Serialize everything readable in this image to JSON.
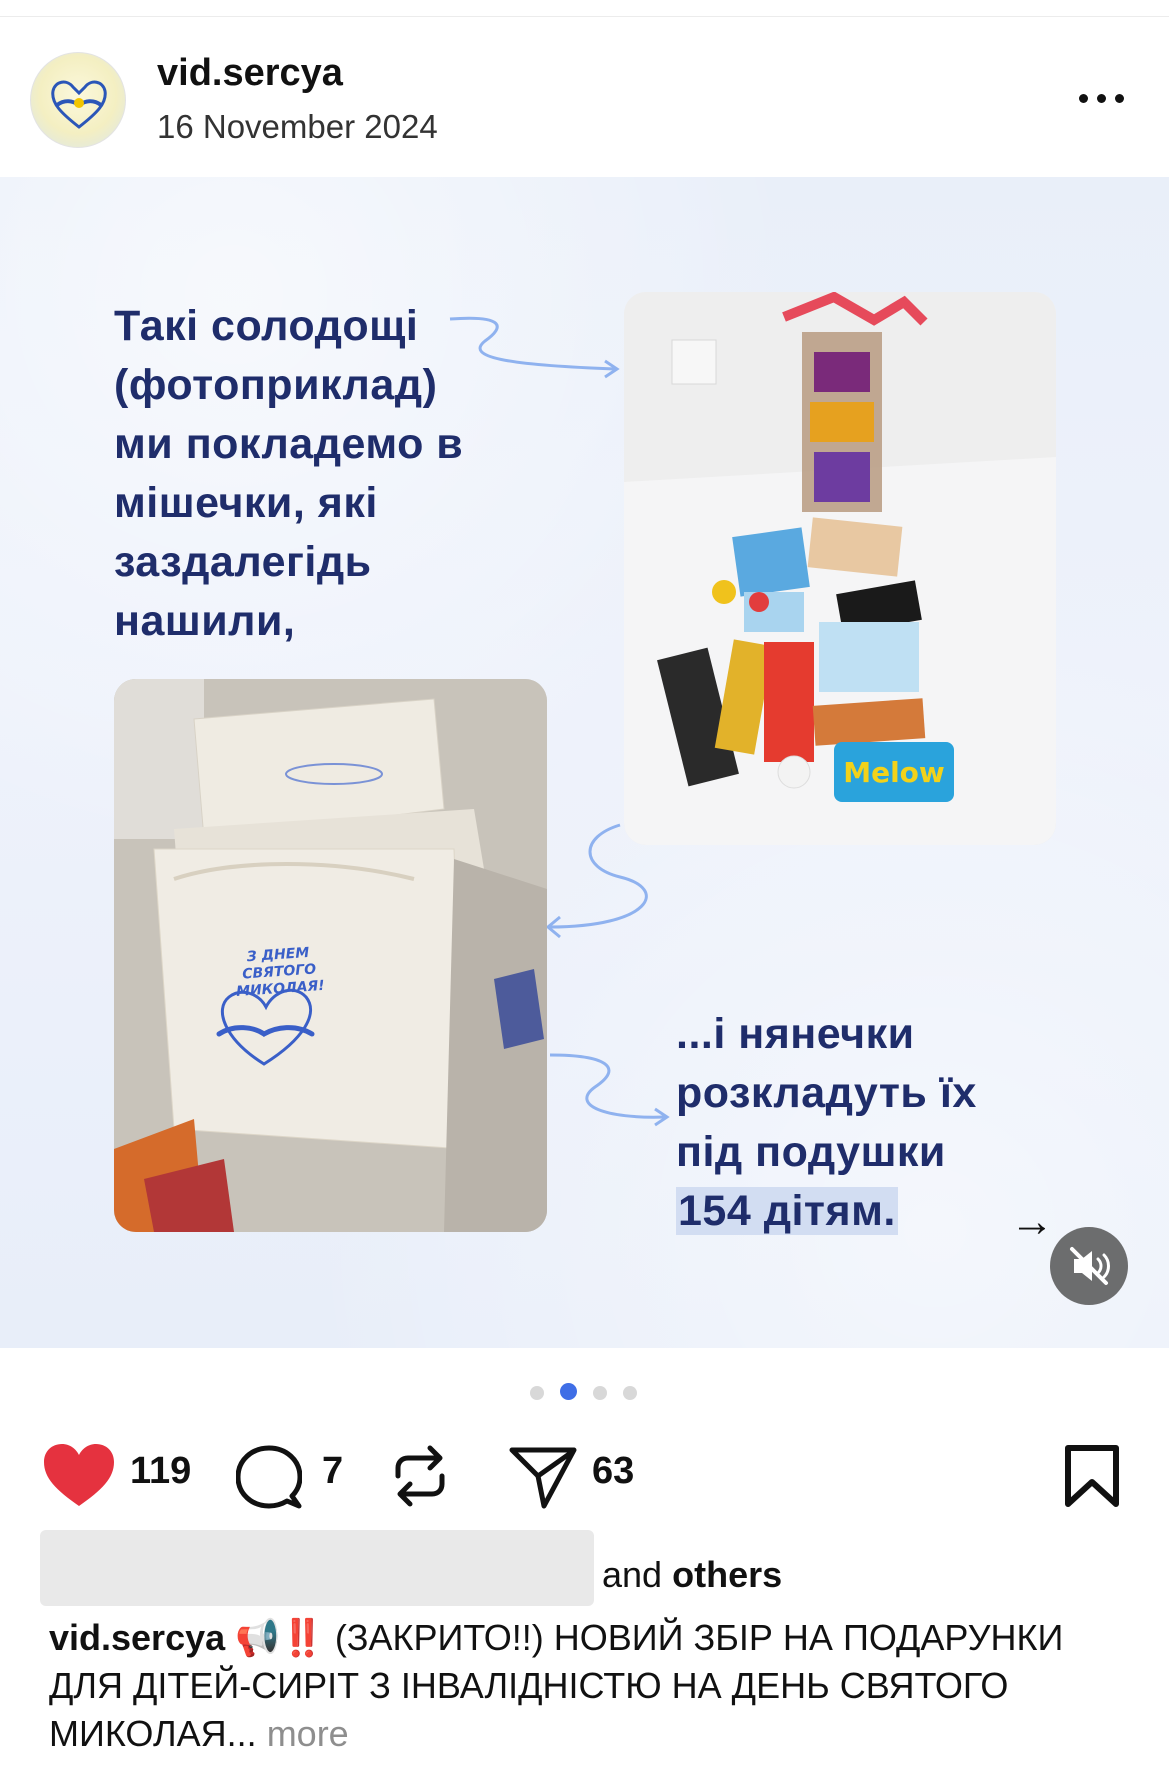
{
  "post": {
    "username": "vid.sercya",
    "date": "16 November 2024"
  },
  "slide": {
    "text_top": "Такі солодощі\n(фотоприклад)\nми покладемо в\nмішечки, які\nзаздалегідь\nнашили,",
    "text_bottom_lines": [
      "...і нянечки",
      "розкладуть їх",
      "під подушки"
    ],
    "text_bottom_highlight": "154 дітям.",
    "bag_print": [
      "З ДНЕМ",
      "СВЯТОГО",
      "МИКОЛАЯ!"
    ],
    "candy_label": "Melow",
    "next_arrow": "→"
  },
  "carousel": {
    "total": 4,
    "active": 2
  },
  "actions": {
    "likes": "119",
    "comments": "7",
    "shares": "63"
  },
  "likes_line": {
    "and": "and",
    "others": "others"
  },
  "caption": {
    "username": "vid.sercya",
    "emoji": "📢‼️",
    "text": " (ЗАКРИТО!!) НОВИЙ ЗБІР НА ПОДАРУНКИ ДЛЯ ДІТЕЙ-СИРІТ З ІНВАЛІДНІСТЮ НА ДЕНЬ СВЯТОГО МИКОЛАЯ...",
    "more": "more"
  },
  "colors": {
    "heart": "#e5323f",
    "slide_text": "#1f2d6b",
    "active_dot": "#3f6ee6"
  },
  "icons": [
    "heart-icon",
    "comment-icon",
    "repost-icon",
    "share-icon",
    "bookmark-icon",
    "more-icon",
    "mute-icon"
  ]
}
